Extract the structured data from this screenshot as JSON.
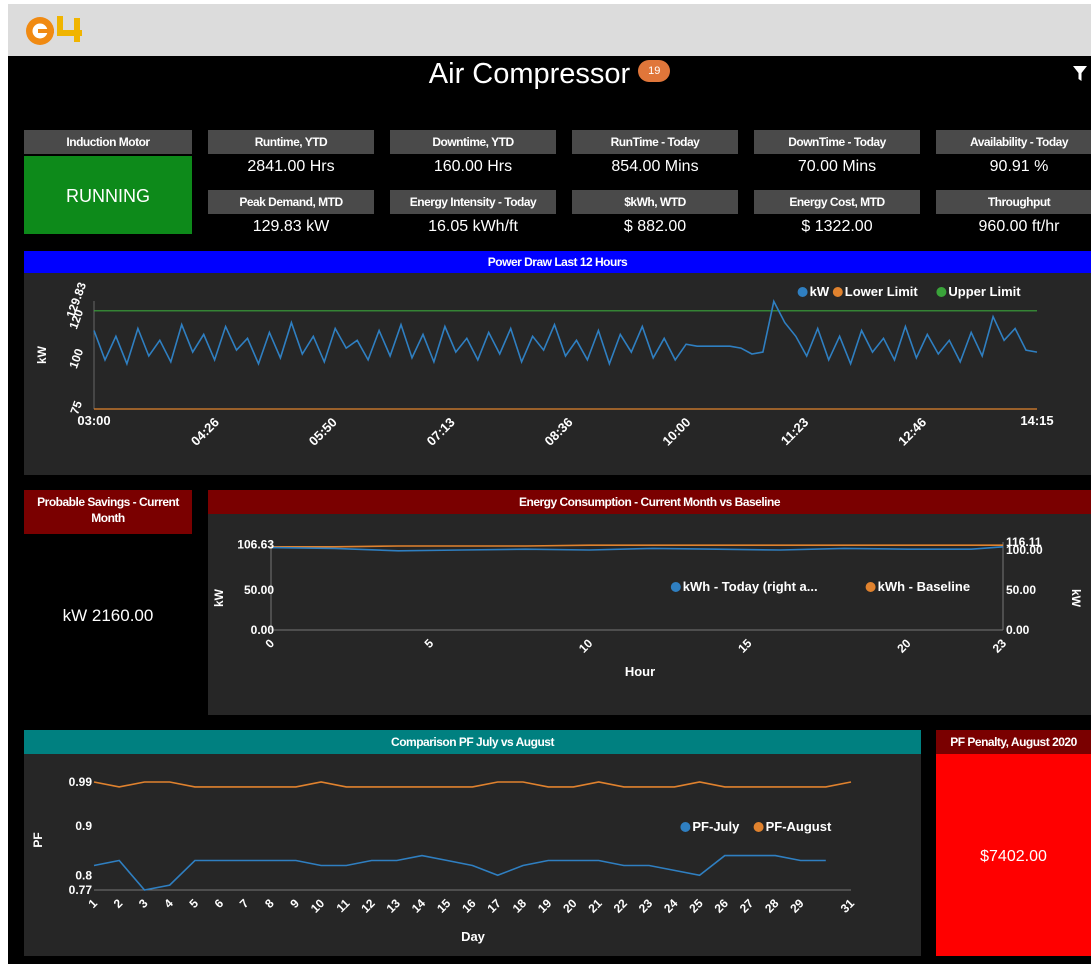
{
  "header": {
    "logo": "e4"
  },
  "dashboard": {
    "title": "Air Compressor",
    "badge": "19",
    "status": {
      "label": "Induction Motor",
      "value": "RUNNING",
      "color": "#0d8a1a"
    },
    "kpis": [
      {
        "label": "Runtime, YTD",
        "value": "2841.00 Hrs"
      },
      {
        "label": "Downtime, YTD",
        "value": "160.00 Hrs"
      },
      {
        "label": "RunTime - Today",
        "value": "854.00 Mins"
      },
      {
        "label": "DownTime - Today",
        "value": "70.00 Mins"
      },
      {
        "label": "Availability - Today",
        "value": "90.91 %"
      },
      {
        "label": "Peak Demand, MTD",
        "value": "129.83 kW"
      },
      {
        "label": "Energy Intensity - Today",
        "value": "16.05 kWh/ft"
      },
      {
        "label": "$kWh, WTD",
        "value": "$ 882.00"
      },
      {
        "label": "Energy Cost, MTD",
        "value": "$ 1322.00"
      },
      {
        "label": "Throughput",
        "value": "960.00 ft/hr"
      }
    ],
    "savings": {
      "label": "Probable Savings - Current Month",
      "value": "kW 2160.00"
    },
    "penalty": {
      "label": "PF Penalty, August 2020",
      "value": "$7402.00"
    }
  },
  "colors": {
    "blue_series": "#2f7fc1",
    "orange_series": "#e0822e",
    "green_series": "#3aa33a",
    "power_header": "#0000ff",
    "energy_header": "#7a0000",
    "pf_header": "#008080",
    "penalty": "#ff0000"
  },
  "chart_data": [
    {
      "type": "line",
      "title": "Power Draw Last 12 Hours",
      "ylabel": "kW",
      "x_ticks": [
        "03:00",
        "04:26",
        "05:50",
        "07:13",
        "08:36",
        "10:00",
        "11:23",
        "12:46",
        "14:15"
      ],
      "y_ticks": [
        "75",
        "100",
        "120",
        "129.83"
      ],
      "ylim": [
        75,
        130
      ],
      "legend": "top-right",
      "series": [
        {
          "name": "kW",
          "values": [
            115,
            100,
            112,
            98,
            116,
            102,
            110,
            99,
            118,
            104,
            113,
            100,
            117,
            105,
            111,
            98,
            114,
            101,
            119,
            103,
            112,
            99,
            116,
            106,
            110,
            100,
            115,
            102,
            118,
            101,
            113,
            99,
            117,
            104,
            111,
            100,
            114,
            103,
            116,
            99,
            112,
            105,
            118,
            102,
            110,
            100,
            115,
            98,
            113,
            104,
            117,
            101,
            111,
            100,
            108,
            107,
            107,
            107,
            107,
            106,
            103,
            104,
            129.8,
            119,
            112,
            102,
            116,
            100,
            112,
            98,
            115,
            104,
            111,
            100,
            117,
            101,
            113,
            103,
            110,
            99,
            114,
            102,
            122,
            110,
            116,
            105,
            104
          ],
          "note_times": "03:00 to 14:15"
        },
        {
          "name": "Lower Limit",
          "values": [
            75,
            75
          ]
        },
        {
          "name": "Upper Limit",
          "values": [
            125,
            125
          ]
        }
      ]
    },
    {
      "type": "line",
      "title": "Energy Consumption - Current Month vs Baseline",
      "xlabel": "Hour",
      "ylabel": "kW",
      "x_ticks": [
        "0",
        "5",
        "10",
        "15",
        "20",
        "23"
      ],
      "y_ticks_left": [
        "0.00",
        "50.00",
        "106.63"
      ],
      "y_ticks_right": [
        "0.00",
        "50.00",
        "100.00",
        "116.11"
      ],
      "ylim": [
        0,
        110
      ],
      "legend": "top-right",
      "series": [
        {
          "name": "kWh - Today (right a...",
          "x": [
            0,
            2,
            4,
            6,
            8,
            10,
            12,
            14,
            16,
            18,
            20,
            22,
            23
          ],
          "values": [
            103,
            102,
            99,
            100,
            101,
            100,
            102,
            101,
            100,
            102,
            101,
            101,
            104
          ]
        },
        {
          "name": "kWh - Baseline",
          "x": [
            0,
            2,
            4,
            6,
            8,
            10,
            12,
            14,
            16,
            18,
            20,
            22,
            23
          ],
          "values": [
            104,
            104,
            105,
            105,
            105,
            106,
            106,
            106,
            106,
            106,
            106,
            106,
            106
          ]
        }
      ]
    },
    {
      "type": "line",
      "title": "Comparison PF July vs August",
      "xlabel": "Day",
      "ylabel": "PF",
      "categories": [
        "1",
        "2",
        "3",
        "4",
        "5",
        "6",
        "7",
        "8",
        "9",
        "10",
        "11",
        "12",
        "13",
        "14",
        "15",
        "16",
        "17",
        "18",
        "19",
        "20",
        "21",
        "22",
        "23",
        "24",
        "25",
        "26",
        "27",
        "28",
        "29",
        "31"
      ],
      "y_ticks": [
        "0.77",
        "0.8",
        "0.9",
        "0.99"
      ],
      "ylim": [
        0.77,
        0.99
      ],
      "legend": "top-right",
      "series": [
        {
          "name": "PF-July",
          "x": [
            1,
            2,
            3,
            4,
            5,
            6,
            7,
            8,
            9,
            10,
            11,
            12,
            13,
            14,
            15,
            16,
            17,
            18,
            19,
            20,
            21,
            22,
            23,
            24,
            25,
            26,
            27,
            28,
            29,
            30
          ],
          "values": [
            0.82,
            0.83,
            0.77,
            0.78,
            0.83,
            0.83,
            0.83,
            0.83,
            0.83,
            0.82,
            0.82,
            0.83,
            0.83,
            0.84,
            0.83,
            0.82,
            0.8,
            0.82,
            0.83,
            0.83,
            0.83,
            0.82,
            0.82,
            0.81,
            0.8,
            0.84,
            0.84,
            0.84,
            0.83,
            0.83
          ]
        },
        {
          "name": "PF-August",
          "x": [
            1,
            2,
            3,
            4,
            5,
            6,
            7,
            8,
            9,
            10,
            11,
            12,
            13,
            14,
            15,
            16,
            17,
            18,
            19,
            20,
            21,
            22,
            23,
            24,
            25,
            26,
            27,
            28,
            29,
            30,
            31
          ],
          "values": [
            0.99,
            0.98,
            0.99,
            0.99,
            0.98,
            0.98,
            0.98,
            0.98,
            0.98,
            0.99,
            0.98,
            0.98,
            0.98,
            0.98,
            0.98,
            0.98,
            0.99,
            0.99,
            0.98,
            0.98,
            0.99,
            0.98,
            0.98,
            0.98,
            0.99,
            0.98,
            0.98,
            0.98,
            0.98,
            0.98,
            0.99
          ]
        }
      ]
    }
  ]
}
